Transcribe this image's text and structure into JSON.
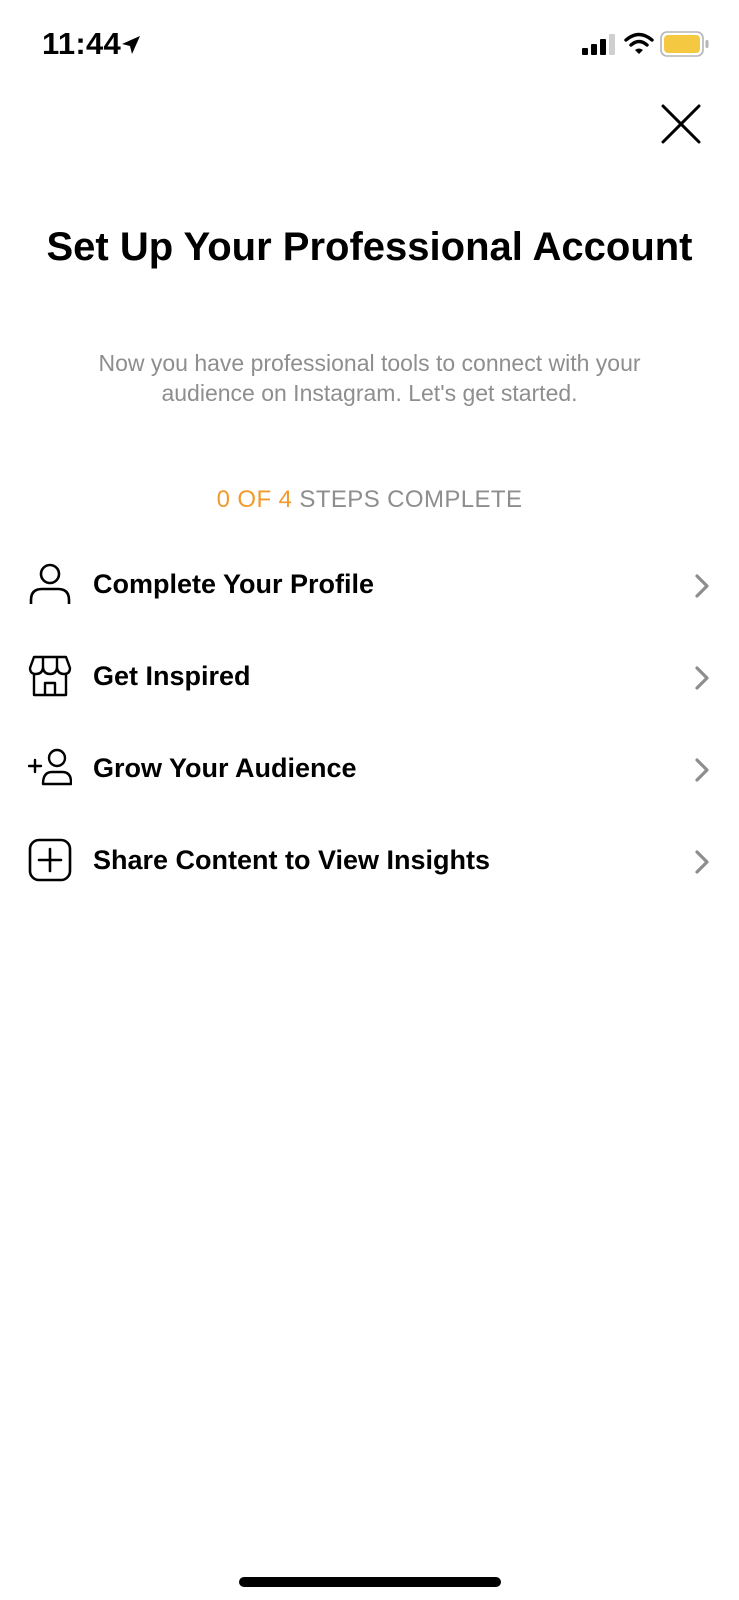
{
  "status_bar": {
    "time": "11:44",
    "battery_color": "#f5c842"
  },
  "header": {
    "title": "Set Up Your Professional Account",
    "subtitle": "Now you have professional tools to connect with your audience on Instagram. Let's get started."
  },
  "progress": {
    "count_text": "0 OF 4",
    "rest_text": "STEPS COMPLETE",
    "completed": 0,
    "total": 4,
    "accent_color": "#f29a2e"
  },
  "steps": [
    {
      "label": "Complete Your Profile",
      "icon": "person-icon"
    },
    {
      "label": "Get Inspired",
      "icon": "storefront-icon"
    },
    {
      "label": "Grow Your Audience",
      "icon": "add-person-icon"
    },
    {
      "label": "Share Content to View Insights",
      "icon": "add-square-icon"
    }
  ]
}
